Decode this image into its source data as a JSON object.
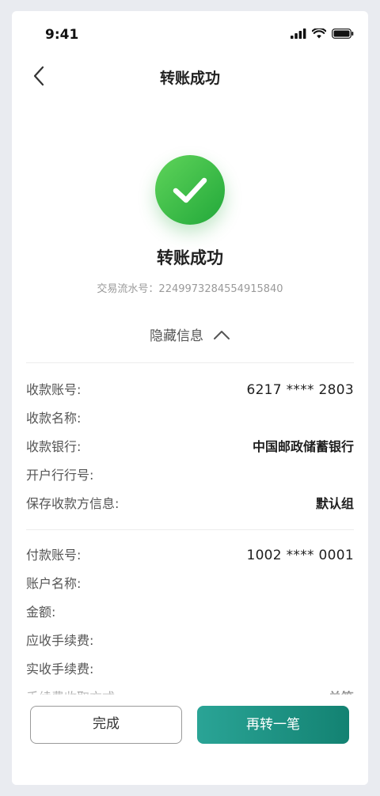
{
  "status_bar": {
    "time": "9:41"
  },
  "nav": {
    "title": "转账成功"
  },
  "result": {
    "title": "转账成功",
    "txn_label": "交易流水号：",
    "txn_number": "2249973284554915840"
  },
  "toggle": {
    "label": "隐藏信息"
  },
  "payee": [
    {
      "key": "收款账号:",
      "value": "6217 **** 2803"
    },
    {
      "key": "收款名称:",
      "value": ""
    },
    {
      "key": "收款银行:",
      "value": "中国邮政储蓄银行"
    },
    {
      "key": "开户行行号:",
      "value": ""
    },
    {
      "key": "保存收款方信息:",
      "value": "默认组"
    }
  ],
  "payer": [
    {
      "key": "付款账号:",
      "value": "1002 **** 0001"
    },
    {
      "key": "账户名称:",
      "value": ""
    },
    {
      "key": "金额:",
      "value": ""
    },
    {
      "key": "应收手续费:",
      "value": ""
    },
    {
      "key": "实收手续费:",
      "value": ""
    },
    {
      "key": "手续费收取方式:",
      "value": "单笔"
    }
  ],
  "buttons": {
    "done": "完成",
    "again": "再转一笔"
  },
  "colors": {
    "success_green": "#2fb646",
    "primary_teal": "#1a8f80"
  }
}
